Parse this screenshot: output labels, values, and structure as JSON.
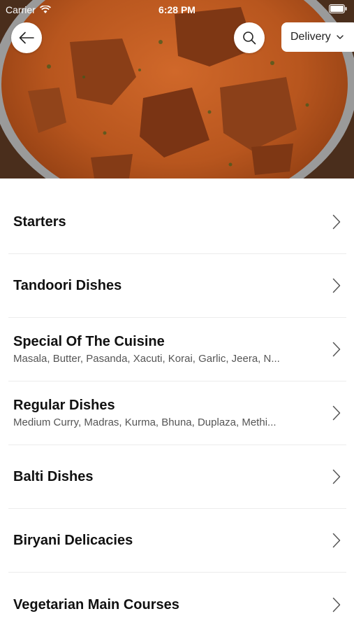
{
  "status_bar": {
    "carrier": "Carrier",
    "time": "6:28 PM"
  },
  "header": {
    "hero_image": "curry-dish-photo",
    "delivery_label": "Delivery"
  },
  "menu": {
    "categories": [
      {
        "title": "Starters",
        "subtitle": ""
      },
      {
        "title": "Tandoori Dishes",
        "subtitle": ""
      },
      {
        "title": "Special Of The Cuisine",
        "subtitle": "Masala, Butter, Pasanda, Xacuti, Korai, Garlic, Jeera, N..."
      },
      {
        "title": "Regular Dishes",
        "subtitle": "Medium Curry, Madras, Kurma, Bhuna, Duplaza, Methi..."
      },
      {
        "title": "Balti Dishes",
        "subtitle": ""
      },
      {
        "title": "Biryani Delicacies",
        "subtitle": ""
      },
      {
        "title": "Vegetarian Main Courses",
        "subtitle": ""
      }
    ]
  },
  "colors": {
    "curry": "#b8561e",
    "divider": "#ececec"
  }
}
